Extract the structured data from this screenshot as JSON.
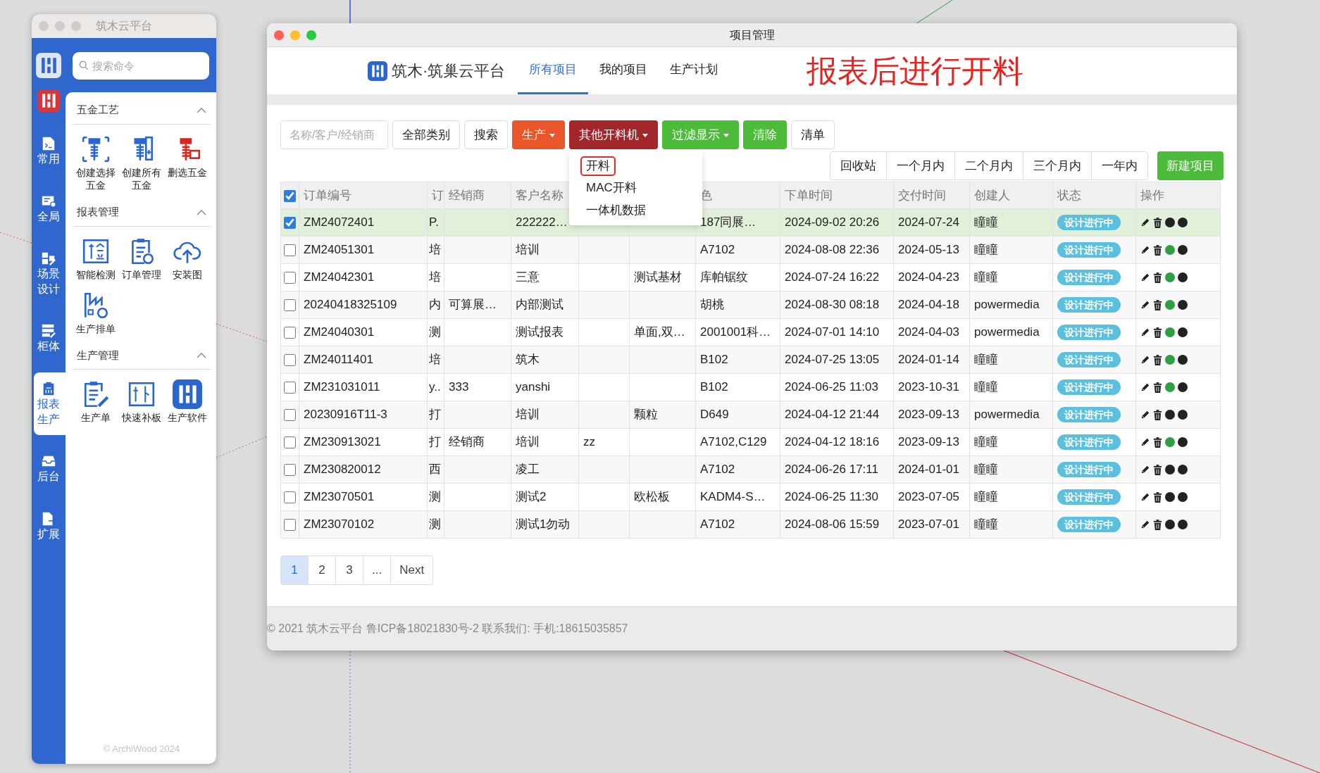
{
  "sidebar_window": {
    "title": "筑木云平台",
    "search": {
      "placeholder": "搜索命令"
    },
    "rail": [
      {
        "label": "常用",
        "selected": false
      },
      {
        "label": "全局",
        "selected": false
      },
      {
        "label": "场景设计",
        "selected": false
      },
      {
        "label": "柜体",
        "selected": false
      },
      {
        "label": "报表生产",
        "selected": true
      },
      {
        "label": "后台",
        "selected": false
      },
      {
        "label": "扩展",
        "selected": false
      }
    ],
    "sections": [
      {
        "title": "五金工艺",
        "expanded": true,
        "tools": [
          "创建选择五金",
          "创建所有五金",
          "删选五金"
        ]
      },
      {
        "title": "报表管理",
        "expanded": true,
        "tools": [
          "智能检测",
          "订单管理",
          "安装图",
          "生产排单"
        ]
      },
      {
        "title": "生产管理",
        "expanded": true,
        "tools": [
          "生产单",
          "快速补板",
          "生产软件"
        ]
      }
    ],
    "footer": "© ArchiWood 2024"
  },
  "main_window": {
    "title": "项目管理",
    "brand": "筑木·筑巢云平台",
    "tabs": [
      {
        "label": "所有项目",
        "selected": true
      },
      {
        "label": "我的项目",
        "selected": false
      },
      {
        "label": "生产计划",
        "selected": false
      }
    ],
    "annotation": "报表后进行开料",
    "toolbar": {
      "search": {
        "placeholder": "名称/客户/经销商"
      },
      "buttons": [
        {
          "label": "全部类别",
          "dropdown": false
        },
        {
          "label": "搜索",
          "dropdown": false
        },
        {
          "label": "生产",
          "color": "#e8562a",
          "dropdown": true
        },
        {
          "label": "其他开料机",
          "color": "#a3272a",
          "dropdown": true,
          "menu": [
            {
              "label": "开料",
              "outlined": true
            },
            {
              "label": "MAC开料",
              "outlined": false
            },
            {
              "label": "一体机数据",
              "outlined": false
            }
          ]
        },
        {
          "label": "过滤显示",
          "color": "#4cbb3a",
          "dropdown": true
        },
        {
          "label": "清除",
          "color": "#4cbb3a",
          "dropdown": false
        },
        {
          "label": "清单",
          "dropdown": false
        }
      ],
      "periods": [
        {
          "label": "回收站",
          "selected": false
        },
        {
          "label": "一个月内",
          "selected": false
        },
        {
          "label": "二个月内",
          "selected": false
        },
        {
          "label": "三个月内",
          "selected": false
        },
        {
          "label": "一年内",
          "selected": false
        }
      ],
      "new_button": {
        "label": "新建项目"
      }
    },
    "table": {
      "all_checked": true,
      "header": {
        "order_no": "订单编号",
        "column_2": "订",
        "dealer": "经销商",
        "customer": "客户名称",
        "finish": "色",
        "order_time": "下单时间",
        "delivery_date": "交付时间",
        "creator": "创建人",
        "status": "状态",
        "actions": "操作"
      },
      "rows": [
        {
          "checked": true,
          "order_no": "ZM24072401",
          "column_2": "P.",
          "customer": "222222…",
          "finish": "187同展…",
          "order_time": "2024-09-02 20:26",
          "delivery_date": "2024-07-24",
          "creator": "瞳瞳",
          "status": "设计进行中",
          "indicators": [
            {
              "color": "#222222"
            },
            {
              "color": "#222222"
            }
          ]
        },
        {
          "checked": false,
          "order_no": "ZM24051301",
          "column_2": "培",
          "customer": "培训",
          "finish": "A7102",
          "order_time": "2024-08-08 22:36",
          "delivery_date": "2024-05-13",
          "creator": "瞳瞳",
          "status": "设计进行中",
          "indicators": [
            {
              "color": "#2ea043"
            },
            {
              "color": "#222222"
            }
          ]
        },
        {
          "checked": false,
          "order_no": "ZM24042301",
          "column_2": "培",
          "customer": "三意",
          "column_6": "测试基材",
          "finish": "库帕锯纹",
          "order_time": "2024-07-24 16:22",
          "delivery_date": "2024-04-23",
          "creator": "瞳瞳",
          "status": "设计进行中",
          "indicators": [
            {
              "color": "#2ea043"
            },
            {
              "color": "#222222"
            }
          ]
        },
        {
          "checked": false,
          "order_no": "20240418325109",
          "column_2": "内",
          "dealer": "可算展…",
          "customer": "内部测试",
          "finish": "胡桃",
          "order_time": "2024-08-30 08:18",
          "delivery_date": "2024-04-18",
          "creator": "powermedia",
          "status": "设计进行中",
          "indicators": [
            {
              "color": "#2ea043"
            },
            {
              "color": "#222222"
            }
          ]
        },
        {
          "checked": false,
          "order_no": "ZM24040301",
          "column_2": "测",
          "customer": "测试报表",
          "column_6": "单面,双…",
          "finish": "2001001科…",
          "order_time": "2024-07-01 14:10",
          "delivery_date": "2024-04-03",
          "creator": "powermedia",
          "status": "设计进行中",
          "indicators": [
            {
              "color": "#2ea043"
            },
            {
              "color": "#222222"
            }
          ]
        },
        {
          "checked": false,
          "order_no": "ZM24011401",
          "column_2": "培",
          "customer": "筑木",
          "finish": "B102",
          "order_time": "2024-07-25 13:05",
          "delivery_date": "2024-01-14",
          "creator": "瞳瞳",
          "status": "设计进行中",
          "indicators": [
            {
              "color": "#2ea043"
            },
            {
              "color": "#222222"
            }
          ]
        },
        {
          "checked": false,
          "order_no": "ZM231031011",
          "column_2": "y..",
          "dealer": "333",
          "customer": "yanshi",
          "finish": "B102",
          "order_time": "2024-06-25 11:03",
          "delivery_date": "2023-10-31",
          "creator": "瞳瞳",
          "status": "设计进行中",
          "indicators": [
            {
              "color": "#2ea043"
            },
            {
              "color": "#222222"
            }
          ]
        },
        {
          "checked": false,
          "order_no": "20230916T11-3",
          "column_2": "打",
          "customer": "培训",
          "column_6": "颗粒",
          "finish": "D649",
          "order_time": "2024-04-12 21:44",
          "delivery_date": "2023-09-13",
          "creator": "powermedia",
          "status": "设计进行中",
          "indicators": [
            {
              "color": "#222222"
            },
            {
              "color": "#222222"
            }
          ]
        },
        {
          "checked": false,
          "order_no": "ZM230913021",
          "column_2": "打",
          "dealer": "经销商",
          "customer": "培训",
          "column_5": "zz",
          "finish": "A7102,C129",
          "order_time": "2024-04-12 18:16",
          "delivery_date": "2023-09-13",
          "creator": "瞳瞳",
          "status": "设计进行中",
          "indicators": [
            {
              "color": "#2ea043"
            },
            {
              "color": "#222222"
            }
          ]
        },
        {
          "checked": false,
          "order_no": "ZM230820012",
          "column_2": "西",
          "customer": "凌工",
          "finish": "A7102",
          "order_time": "2024-06-26 17:11",
          "delivery_date": "2024-01-01",
          "creator": "瞳瞳",
          "status": "设计进行中",
          "indicators": [
            {
              "color": "#222222"
            },
            {
              "color": "#222222"
            }
          ]
        },
        {
          "checked": false,
          "order_no": "ZM23070501",
          "column_2": "测",
          "customer": "测试2",
          "column_6": "欧松板",
          "finish": "KADM4-S…",
          "order_time": "2024-06-25 11:30",
          "delivery_date": "2023-07-05",
          "creator": "瞳瞳",
          "status": "设计进行中",
          "indicators": [
            {
              "color": "#222222"
            },
            {
              "color": "#222222"
            }
          ]
        },
        {
          "checked": false,
          "order_no": "ZM23070102",
          "column_2": "测",
          "customer": "测试1勿动",
          "finish": "A7102",
          "order_time": "2024-08-06 15:59",
          "delivery_date": "2023-07-01",
          "creator": "瞳瞳",
          "status": "设计进行中",
          "indicators": [
            {
              "color": "#222222"
            },
            {
              "color": "#222222"
            }
          ]
        }
      ]
    },
    "pagination": [
      {
        "label": "1",
        "selected": true
      },
      {
        "label": "2",
        "selected": false
      },
      {
        "label": "3",
        "selected": false
      },
      {
        "label": "...",
        "selected": false
      },
      {
        "label": "Next",
        "selected": false
      }
    ],
    "footer": "© 2021 筑木云平台 鲁ICP备18021830号-2 联系我们: 手机:18615035857"
  }
}
